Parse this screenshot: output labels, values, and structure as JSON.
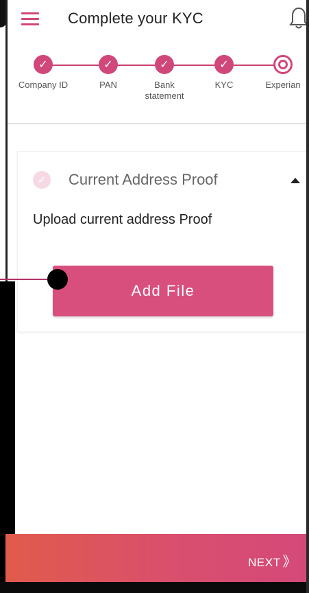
{
  "header": {
    "title": "Complete your KYC"
  },
  "stepper": {
    "steps": [
      {
        "label": "Company ID",
        "status": "done"
      },
      {
        "label": "PAN",
        "status": "done"
      },
      {
        "label": "Bank statement",
        "status": "done"
      },
      {
        "label": "KYC",
        "status": "done"
      },
      {
        "label": "Experian",
        "status": "current"
      }
    ]
  },
  "section": {
    "title": "Current Address Proof",
    "instruction": "Upload current address Proof",
    "add_button": "Add File"
  },
  "footer": {
    "next_label": "NEXT"
  },
  "colors": {
    "accent": "#d84f7d",
    "footer_start": "#e15b4b",
    "footer_end": "#d4497a"
  },
  "icons": {
    "menu": "hamburger-icon",
    "notifications": "bell-icon",
    "check": "check-icon",
    "next": "double-chevron-right-icon",
    "collapse": "caret-up-icon"
  }
}
